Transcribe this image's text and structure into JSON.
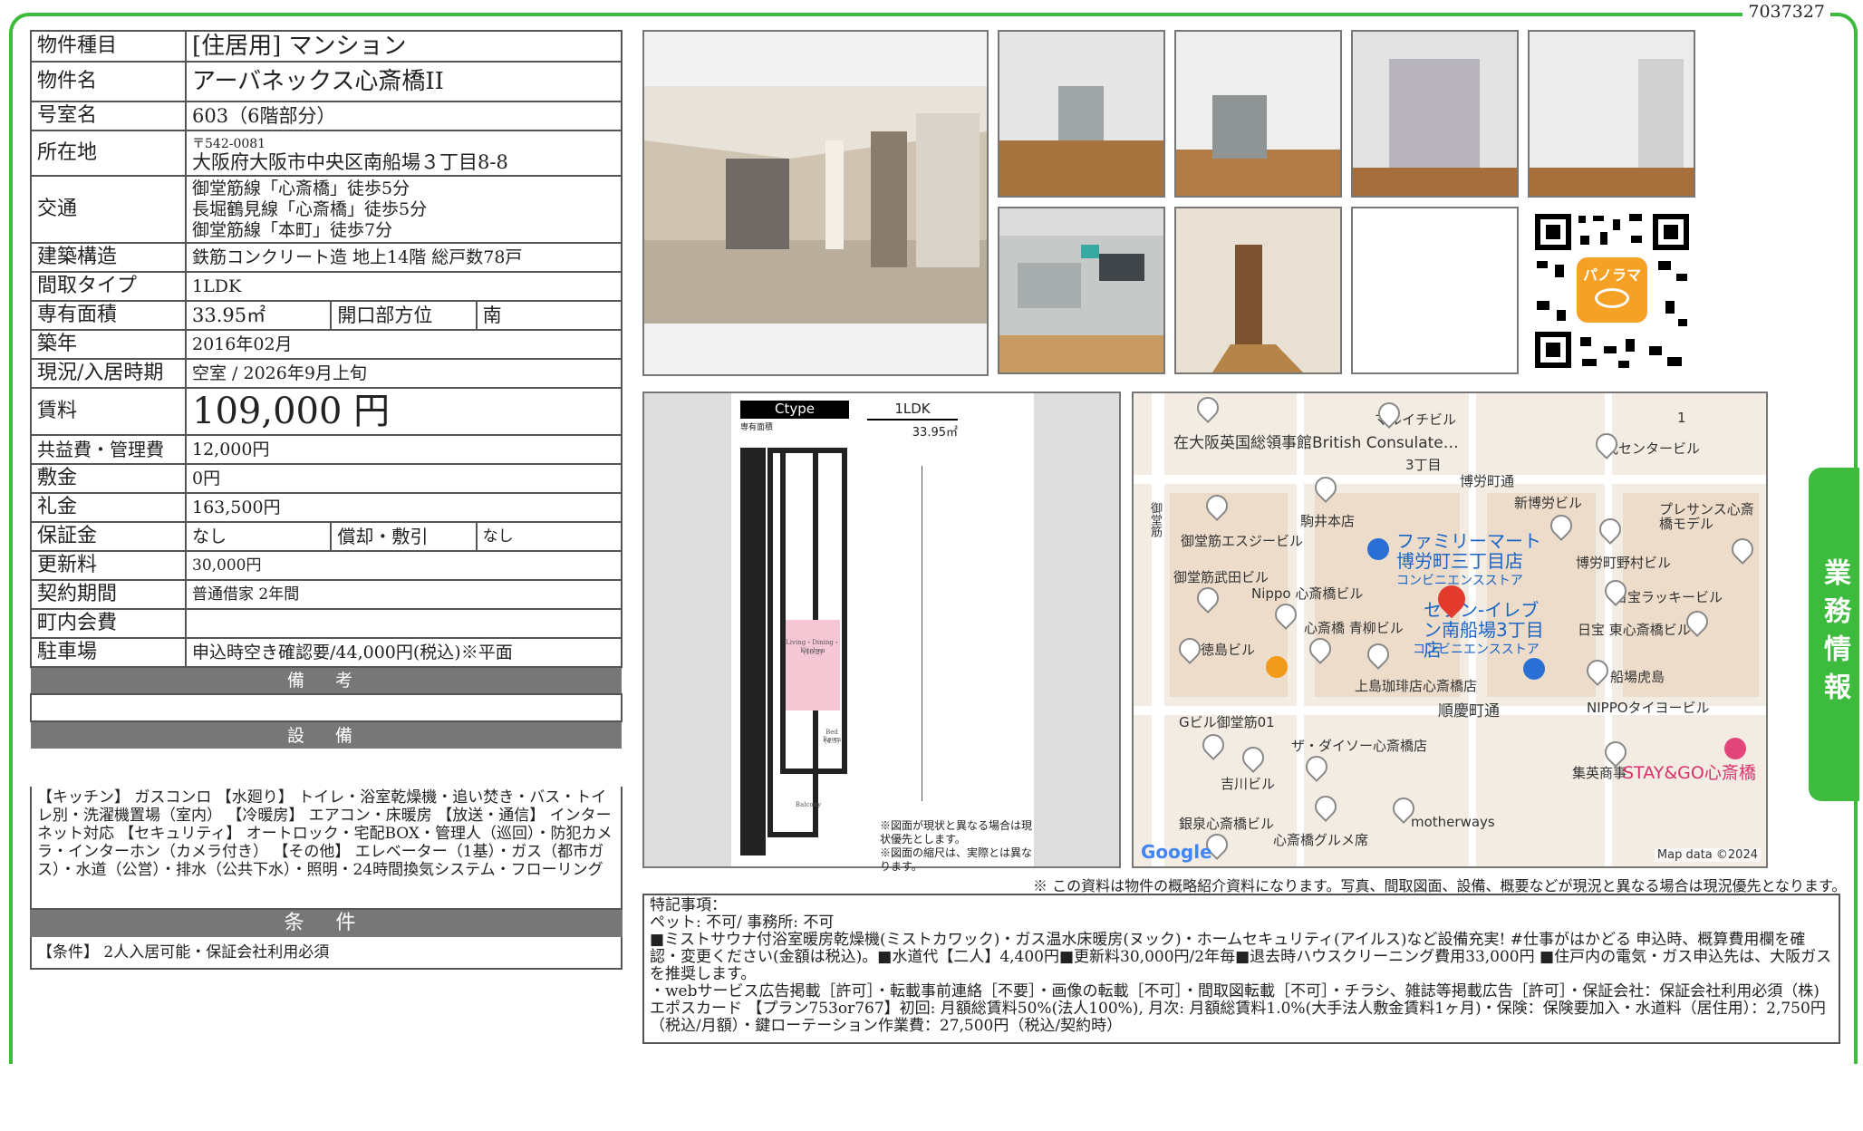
{
  "doc_id": "7037327",
  "spec": {
    "type_label": "物件種目",
    "type_value": "[住居用] マンション",
    "name_label": "物件名",
    "name_value": "アーバネックス心斎橋II",
    "room_label": "号室名",
    "room_value": "603（6階部分）",
    "addr_label": "所在地",
    "addr_zip": "〒542-0081",
    "addr_value": "大阪府大阪市中央区南船場３丁目8-8",
    "access_label": "交通",
    "access": [
      "御堂筋線「心斎橋」徒歩5分",
      "長堀鶴見線「心斎橋」徒歩5分",
      "御堂筋線「本町」徒歩7分"
    ],
    "struct_label": "建築構造",
    "struct_value": "鉄筋コンクリート造 地上14階 総戸数78戸",
    "layout_label": "間取タイプ",
    "layout_value": "1LDK",
    "area_label": "専有面積",
    "area_value": "33.95㎡",
    "dir_label": "開口部方位",
    "dir_value": "南",
    "built_label": "築年",
    "built_value": "2016年02月",
    "status_label": "現況/入居時期",
    "status_value": "空室 / 2026年9月上旬",
    "rent_label": "賃料",
    "rent_value": "109,000 円",
    "fee_label": "共益費・管理費",
    "fee_value": "12,000円",
    "deposit_label": "敷金",
    "deposit_value": "0円",
    "key_label": "礼金",
    "key_value": "163,500円",
    "guar_label": "保証金",
    "guar_value": "なし",
    "amort_label": "償却・敷引",
    "amort_value": "なし",
    "renew_label": "更新料",
    "renew_value": "30,000円",
    "contract_label": "契約期間",
    "contract_value": "普通借家 2年間",
    "town_label": "町内会費",
    "town_value": "",
    "parking_label": "駐車場",
    "parking_value": "申込時空き確認要/44,000円(税込)※平面"
  },
  "sections": {
    "remarks_title": "備 考",
    "equip_title": "設 備",
    "cond_title": "条 件"
  },
  "equipment": "【キッチン】 ガスコンロ 【水廻り】 トイレ・浴室乾燥機・追い焚き・バス・トイレ別・洗濯機置場（室内） 【冷暖房】 エアコン・床暖房 【放送・通信】 インターネット対応 【セキュリティ】 オートロック・宅配BOX・管理人（巡回）・防犯カメラ・インターホン（カメラ付き） 【その他】 エレベーター（1基）・ガス（都市ガス）・水道（公営）・排水（公共下水）・照明・24時間換気システム・フローリング",
  "conditions": "【条件】 2人入居可能・保証会社利用必須",
  "floorplan": {
    "type": "Ctype",
    "layout": "1LDK",
    "area_caption": "専有面積",
    "area": "33.95㎡",
    "ldk_label": "Living・Dining・Kitchen",
    "ldk_size": "(10.2)",
    "bed_label": "Bed Room",
    "bed_size": "(4.5)",
    "balcony_label": "Balcony",
    "note1": "※図面が現状と異なる場合は現状優先とします。",
    "note2": "※図面の縮尺は、実際とは異なります。"
  },
  "qr": {
    "badge": "パノラマ"
  },
  "map": {
    "labels": [
      "在大阪英国総領事館British Consulate…",
      "マルイチビル",
      "1",
      "戎センタービル",
      "3丁目",
      "博労町通",
      "新博労ビル",
      "プレサンス心斎橋モデル",
      "御堂筋",
      "駒井本店",
      "御堂筋エスジービル",
      "博労町野村ビル",
      "御堂筋武田ビル",
      "Nippo 心斎橋ビル",
      "日宝ラッキービル",
      "心斎橋 青柳ビル",
      "日宝 東心斎橋ビル",
      "徳島ビル",
      "上島珈琲店心斎橋店",
      "船場虎島",
      "順慶町通",
      "Gビル御堂筋01",
      "NIPPOタイヨービル",
      "ザ・ダイソー心斎橋店",
      "集英商事",
      "吉川ビル",
      "銀泉心斎橋ビル",
      "motherways",
      "心斎橋グルメ席"
    ],
    "famima": "ファミリーマート博労町三丁目店",
    "famima_sub": "コンビニエンスストア",
    "seven": "セブン-イレブン南船場3丁目店",
    "seven_sub": "コンビニエンスストア",
    "stay": "STAY&GO心斎橋",
    "google": "Google",
    "credit": "Map data ©2024"
  },
  "notice": "※ この資料は物件の概略紹介資料になります。写真、間取図面、設備、概要などが現況と異なる場合は現況優先となります。",
  "remarks": [
    "特記事項：",
    "ペット: 不可/ 事務所: 不可",
    "■ミストサウナ付浴室暖房乾燥機(ミストカワック)・ガス温水床暖房(ヌック)・ホームセキュリティ(アイルス)など設備充実! #仕事がはかどる 申込時、概算費用欄を確認・変更ください(金額は税込)。■水道代【二人】4,400円■更新料30,000円/2年毎■退去時ハウスクリーニング費用33,000円 ■住戸内の電気・ガス申込先は、大阪ガスを推奨します。",
    "・webサービス広告掲載［許可］・転載事前連絡［不要］・画像の転載［不可］・間取図転載［不可］・チラシ、雑誌等掲載広告［許可］・保証会社：保証会社利用必須（株)エポスカード 【プラン753or767】初回: 月額総賃料50%(法人100%), 月次: 月額総賃料1.0%(大手法人敷金賃料1ヶ月)・保険：保険要加入・水道料（居住用）：2,750円（税込/月額）・鍵ローテーション作業費：27,500円（税込/契約時）"
  ],
  "side_tab": "業務情報",
  "colors": {
    "accent": "#3dbb3d",
    "section_bar": "#777777"
  }
}
